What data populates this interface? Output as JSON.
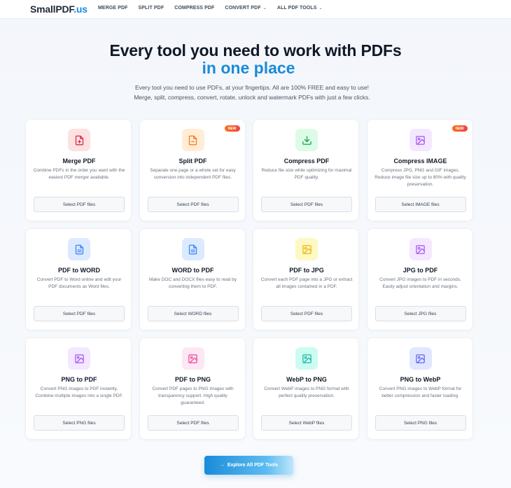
{
  "nav": {
    "logo_main": "SmallPDF",
    "logo_suffix": ".us",
    "links": [
      {
        "label": "MERGE PDF"
      },
      {
        "label": "SPLIT PDF"
      },
      {
        "label": "COMPRESS PDF"
      },
      {
        "label": "CONVERT PDF",
        "dropdown": true
      },
      {
        "label": "ALL PDF TOOLS",
        "dropdown": true
      }
    ]
  },
  "hero": {
    "title_line1": "Every tool you need to work with PDFs",
    "title_line2": "in one place",
    "subtitle_line1": "Every tool you need to use PDFs, at your fingertips. All are 100% FREE and easy to use!",
    "subtitle_line2": "Merge, split, compress, convert, rotate, unlock and watermark PDFs with just a few clicks."
  },
  "colors": {
    "accent": "#1a8bd9",
    "badge": "#f97316"
  },
  "tools": [
    {
      "title": "Merge PDF",
      "desc": "Combine PDFs in the order you want with the easiest PDF merger available.",
      "button": "Select PDF files",
      "icon": "file-plus-icon",
      "icon_bg": "#fde2e2",
      "icon_color": "#e11d48"
    },
    {
      "title": "Split PDF",
      "desc": "Separate one page or a whole set for easy conversion into independent PDF files.",
      "button": "Select PDF files",
      "icon": "file-minus-icon",
      "icon_bg": "#ffedd5",
      "icon_color": "#f97316",
      "badge": "NEW"
    },
    {
      "title": "Compress PDF",
      "desc": "Reduce file size while optimizing for maximal PDF quality.",
      "button": "Select PDF files",
      "icon": "download-icon",
      "icon_bg": "#dcfce7",
      "icon_color": "#16a34a"
    },
    {
      "title": "Compress IMAGE",
      "desc": "Compress JPG, PNG and GIF images. Reduce image file size up to 80% with quality preservation.",
      "button": "Select IMAGE files",
      "icon": "image-icon",
      "icon_bg": "#f3e8ff",
      "icon_color": "#a855f7",
      "badge": "NEW"
    },
    {
      "title": "PDF to WORD",
      "desc": "Convert PDF to Word online and edit your PDF documents as Word files.",
      "button": "Select PDF files",
      "icon": "document-icon",
      "icon_bg": "#dbeafe",
      "icon_color": "#3b82f6"
    },
    {
      "title": "WORD to PDF",
      "desc": "Make DOC and DOCX files easy to read by converting them to PDF.",
      "button": "Select WORD files",
      "icon": "document-icon",
      "icon_bg": "#dbeafe",
      "icon_color": "#3b82f6"
    },
    {
      "title": "PDF to JPG",
      "desc": "Convert each PDF page into a JPG or extract all images contained in a PDF.",
      "button": "Select PDF files",
      "icon": "image-icon",
      "icon_bg": "#fef9c3",
      "icon_color": "#eab308"
    },
    {
      "title": "JPG to PDF",
      "desc": "Convert JPG images to PDF in seconds. Easily adjust orientation and margins.",
      "button": "Select JPG files",
      "icon": "image-icon",
      "icon_bg": "#f3e8ff",
      "icon_color": "#a855f7"
    },
    {
      "title": "PNG to PDF",
      "desc": "Convert PNG images to PDF instantly. Combine multiple images into a single PDF.",
      "button": "Select PNG files",
      "icon": "image-icon",
      "icon_bg": "#f3e8ff",
      "icon_color": "#a855f7"
    },
    {
      "title": "PDF to PNG",
      "desc": "Convert PDF pages to PNG images with transparency support. High quality guaranteed.",
      "button": "Select PDF files",
      "icon": "image-icon",
      "icon_bg": "#fce7f3",
      "icon_color": "#ec4899"
    },
    {
      "title": "WebP to PNG",
      "desc": "Convert WebP images to PNG format with perfect quality preservation.",
      "button": "Select WebP files",
      "icon": "image-icon",
      "icon_bg": "#ccfbf1",
      "icon_color": "#14b8a6"
    },
    {
      "title": "PNG to WebP",
      "desc": "Convert PNG images to WebP format for better compression and faster loading.",
      "button": "Select PNG files",
      "icon": "image-icon",
      "icon_bg": "#e0e7ff",
      "icon_color": "#6366f1"
    }
  ],
  "cta": {
    "arrow": "→",
    "label": "Explore All PDF Tools"
  }
}
